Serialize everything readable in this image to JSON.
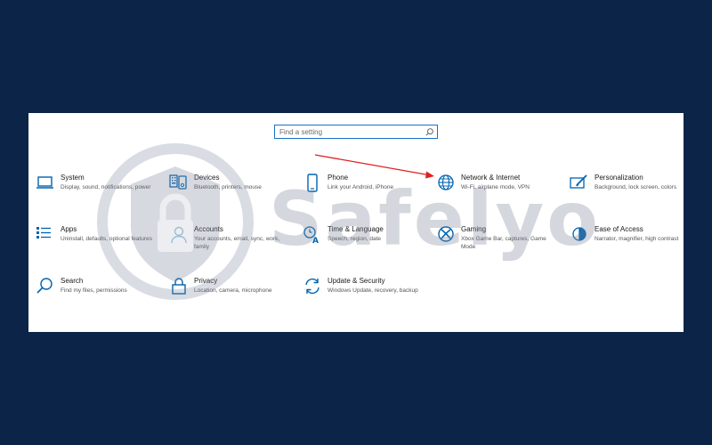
{
  "search": {
    "placeholder": "Find a setting",
    "icon": "search-icon"
  },
  "settings": [
    {
      "key": "system",
      "icon": "laptop-icon",
      "title": "System",
      "desc": "Display, sound, notifications, power"
    },
    {
      "key": "devices",
      "icon": "keyboard-icon",
      "title": "Devices",
      "desc": "Bluetooth, printers, mouse"
    },
    {
      "key": "phone",
      "icon": "phone-icon",
      "title": "Phone",
      "desc": "Link your Android, iPhone"
    },
    {
      "key": "network",
      "icon": "globe-icon",
      "title": "Network & Internet",
      "desc": "Wi-Fi, airplane mode, VPN"
    },
    {
      "key": "personalization",
      "icon": "paint-icon",
      "title": "Personalization",
      "desc": "Background, lock screen, colors"
    },
    {
      "key": "apps",
      "icon": "apps-list-icon",
      "title": "Apps",
      "desc": "Uninstall, defaults, optional features"
    },
    {
      "key": "accounts",
      "icon": "person-icon",
      "title": "Accounts",
      "desc": "Your accounts, email, sync, work, family"
    },
    {
      "key": "time-language",
      "icon": "time-language-icon",
      "title": "Time & Language",
      "desc": "Speech, region, date"
    },
    {
      "key": "gaming",
      "icon": "xbox-icon",
      "title": "Gaming",
      "desc": "Xbox Game Bar, captures, Game Mode"
    },
    {
      "key": "ease-of-access",
      "icon": "ease-of-access-icon",
      "title": "Ease of Access",
      "desc": "Narrator, magnifier, high contrast"
    },
    {
      "key": "search",
      "icon": "magnifier-icon",
      "title": "Search",
      "desc": "Find my files, permissions"
    },
    {
      "key": "privacy",
      "icon": "lock-icon",
      "title": "Privacy",
      "desc": "Location, camera, microphone"
    },
    {
      "key": "update-security",
      "icon": "sync-icon",
      "title": "Update & Security",
      "desc": "Windows Update, recovery, backup"
    }
  ],
  "watermark": {
    "text": "Safelyo"
  },
  "colors": {
    "background": "#0b2447",
    "accent": "#0063b1",
    "arrow": "#e02020"
  }
}
